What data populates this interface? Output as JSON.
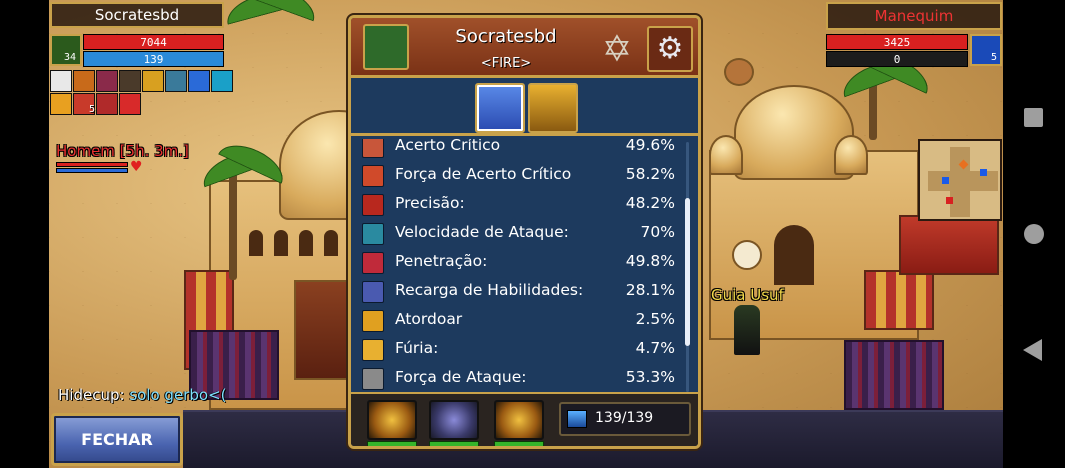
{
  "player": {
    "name": "Socratesbd",
    "hp": "7044",
    "mp": "139",
    "level": "34",
    "buff_stack": "5"
  },
  "target": {
    "name": "Manequim",
    "hp": "3425",
    "mp": "0",
    "rank": "5"
  },
  "world": {
    "npc_label": "Homem [5h. 3m.]",
    "guide_label": "Guia Usuf"
  },
  "chat": {
    "sender": "Hidecup:",
    "message": "solo gerbo<("
  },
  "close_button": "FECHAR",
  "panel": {
    "player_name": "Socratesbd",
    "guild": "<FIRE>",
    "stats": [
      {
        "label": "Acerto Crítico",
        "value": "49.6%",
        "icon": "crit-hit-icon",
        "color": "#c8563a"
      },
      {
        "label": "Força de Acerto Crítico",
        "value": "58.2%",
        "icon": "crit-power-icon",
        "color": "#d04a2a"
      },
      {
        "label": "Precisão:",
        "value": "48.2%",
        "icon": "precision-icon",
        "color": "#b8281e"
      },
      {
        "label": "Velocidade de Ataque:",
        "value": "70%",
        "icon": "attack-speed-icon",
        "color": "#2a8aa0"
      },
      {
        "label": "Penetração:",
        "value": "49.8%",
        "icon": "penetration-icon",
        "color": "#c02a3a"
      },
      {
        "label": "Recarga de Habilidades:",
        "value": "28.1%",
        "icon": "cooldown-icon",
        "color": "#4a5ab0"
      },
      {
        "label": "Atordoar",
        "value": "2.5%",
        "icon": "stun-icon",
        "color": "#e0a020"
      },
      {
        "label": "Fúria:",
        "value": "4.7%",
        "icon": "fury-icon",
        "color": "#e8b030"
      },
      {
        "label": "Força de Ataque:",
        "value": "53.3%",
        "icon": "attack-power-icon",
        "color": "#8a8a8a"
      }
    ],
    "mana": "139/139"
  }
}
